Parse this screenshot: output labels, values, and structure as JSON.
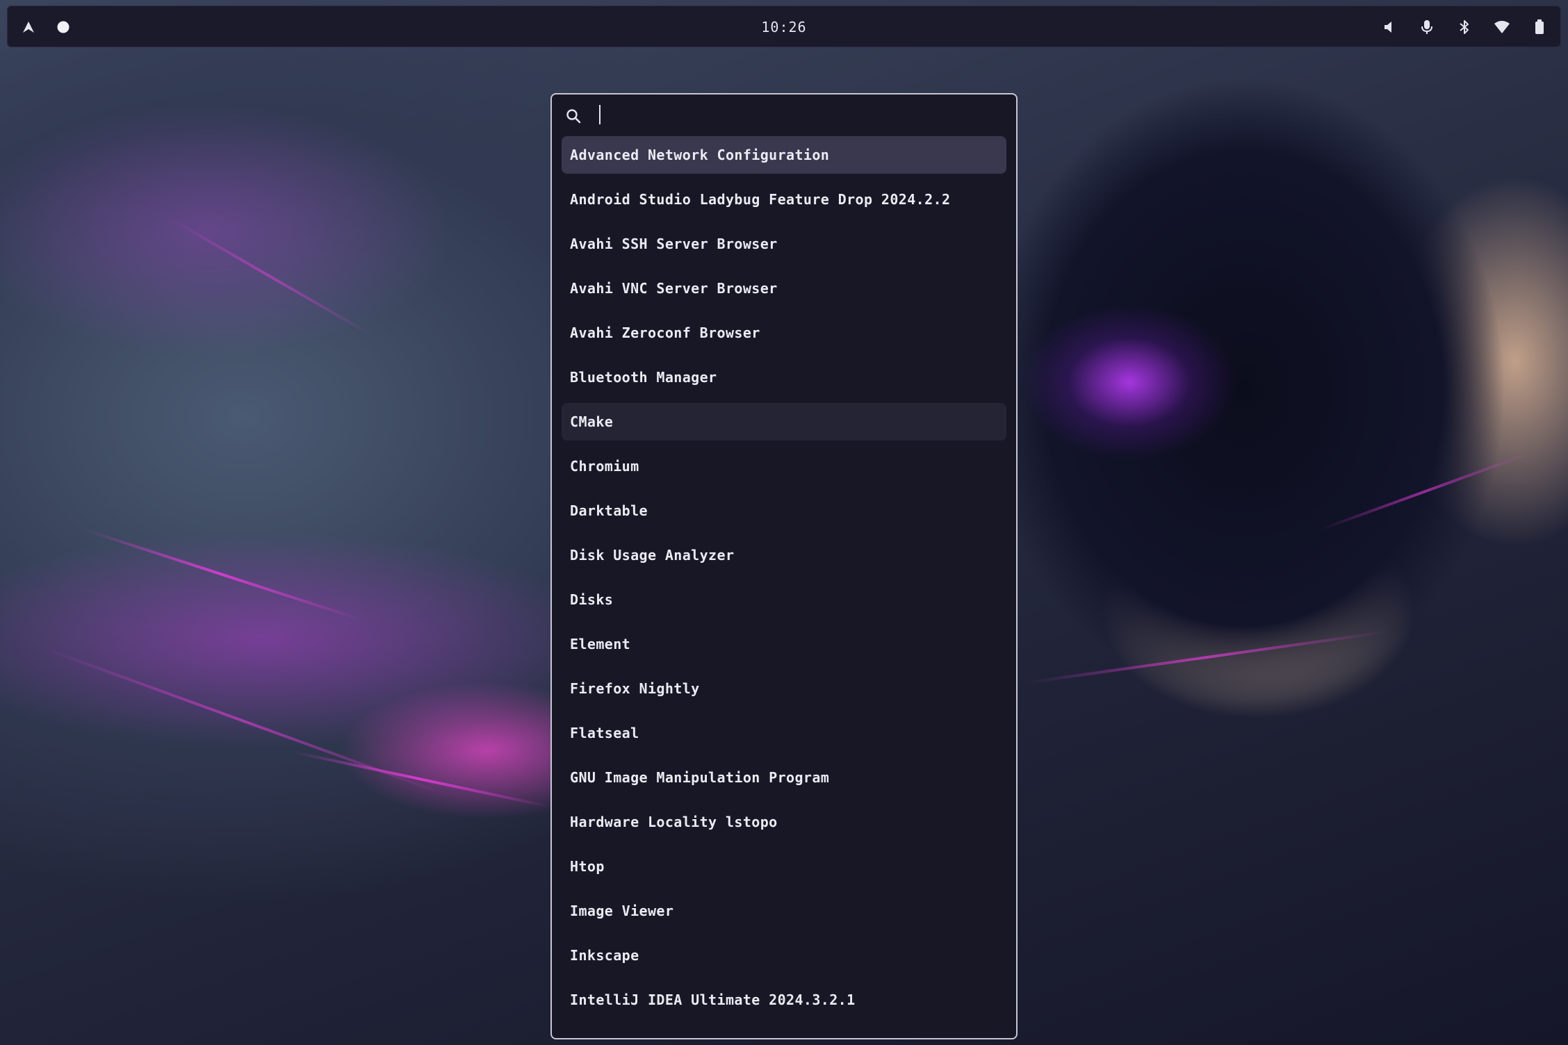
{
  "topbar": {
    "left_icons": [
      "app-launcher-icon",
      "status-dot-icon"
    ],
    "clock": "10:26",
    "right_icons": [
      "volume-icon",
      "microphone-icon",
      "bluetooth-icon",
      "wifi-icon",
      "battery-icon"
    ]
  },
  "launcher": {
    "search": {
      "value": "",
      "placeholder": "",
      "icon": "search-icon"
    },
    "selected_index": 0,
    "hovered_index": 6,
    "results": [
      "Advanced Network Configuration",
      "Android Studio Ladybug Feature Drop 2024.2.2",
      "Avahi SSH Server Browser",
      "Avahi VNC Server Browser",
      "Avahi Zeroconf Browser",
      "Bluetooth Manager",
      "CMake",
      "Chromium",
      "Darktable",
      "Disk Usage Analyzer",
      "Disks",
      "Element",
      "Firefox Nightly",
      "Flatseal",
      "GNU Image Manipulation Program",
      "Hardware Locality lstopo",
      "Htop",
      "Image Viewer",
      "Inkscape",
      "IntelliJ IDEA Ultimate 2024.3.2.1"
    ]
  },
  "colors": {
    "launcher_bg": "#181726",
    "launcher_border": "#c8c6d4",
    "selected_bg": "#3a384f",
    "hover_bg": "#252435",
    "topbar_bg": "#1b1a2b",
    "text": "#ecebf3"
  }
}
